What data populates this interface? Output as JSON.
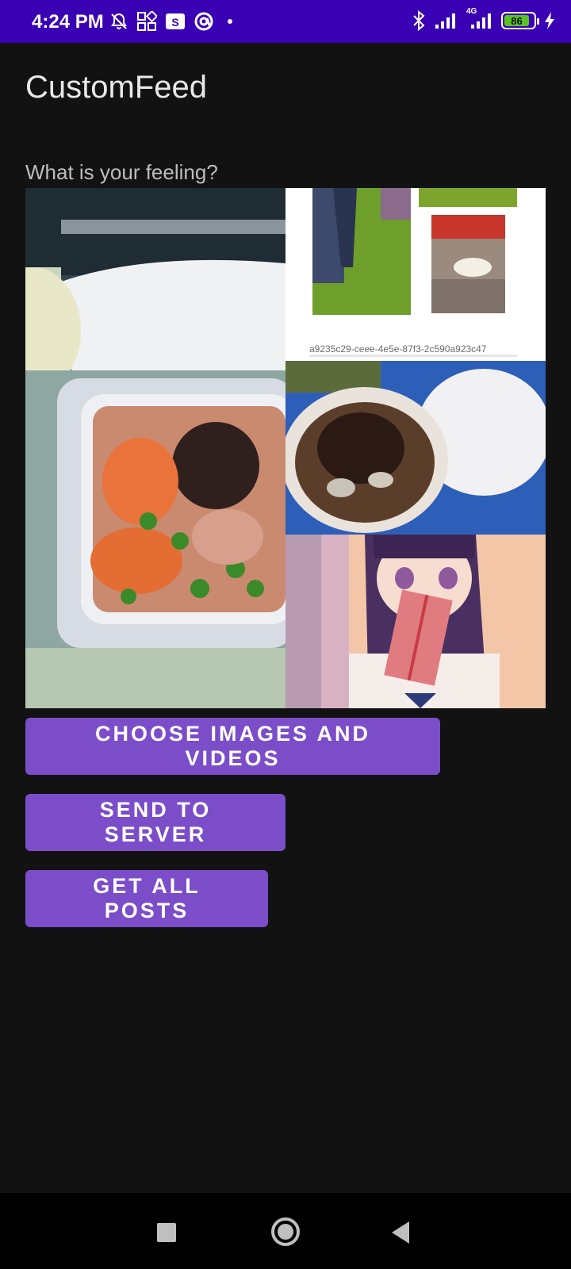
{
  "status_bar": {
    "time": "4:24 PM",
    "battery_level": "86",
    "icons_left": [
      "mute-icon",
      "grid-icon",
      "s-app-icon",
      "at-sign-icon",
      "dot-icon"
    ],
    "icons_right": [
      "bluetooth-icon",
      "signal-icon",
      "signal-4g-icon",
      "battery-icon",
      "charging-icon"
    ],
    "network_label": "4G"
  },
  "app": {
    "title": "CustomFeed"
  },
  "feed": {
    "prompt": "What is your feeling?",
    "images": [
      {
        "name": "airline-meal-photo"
      },
      {
        "name": "collage-photo",
        "caption": "a9235c29-ceee-4e5e-87f3-2c590a923c47"
      },
      {
        "name": "noodle-soup-photo"
      },
      {
        "name": "anime-girl-gift-illustration"
      }
    ]
  },
  "buttons": {
    "choose": "CHOOSE IMAGES AND VIDEOS",
    "send": "SEND TO SERVER",
    "get_all": "GET ALL POSTS"
  },
  "colors": {
    "status_bar": "#3a00b3",
    "background": "#121212",
    "button": "#7b4dc9",
    "battery": "#58c322"
  }
}
